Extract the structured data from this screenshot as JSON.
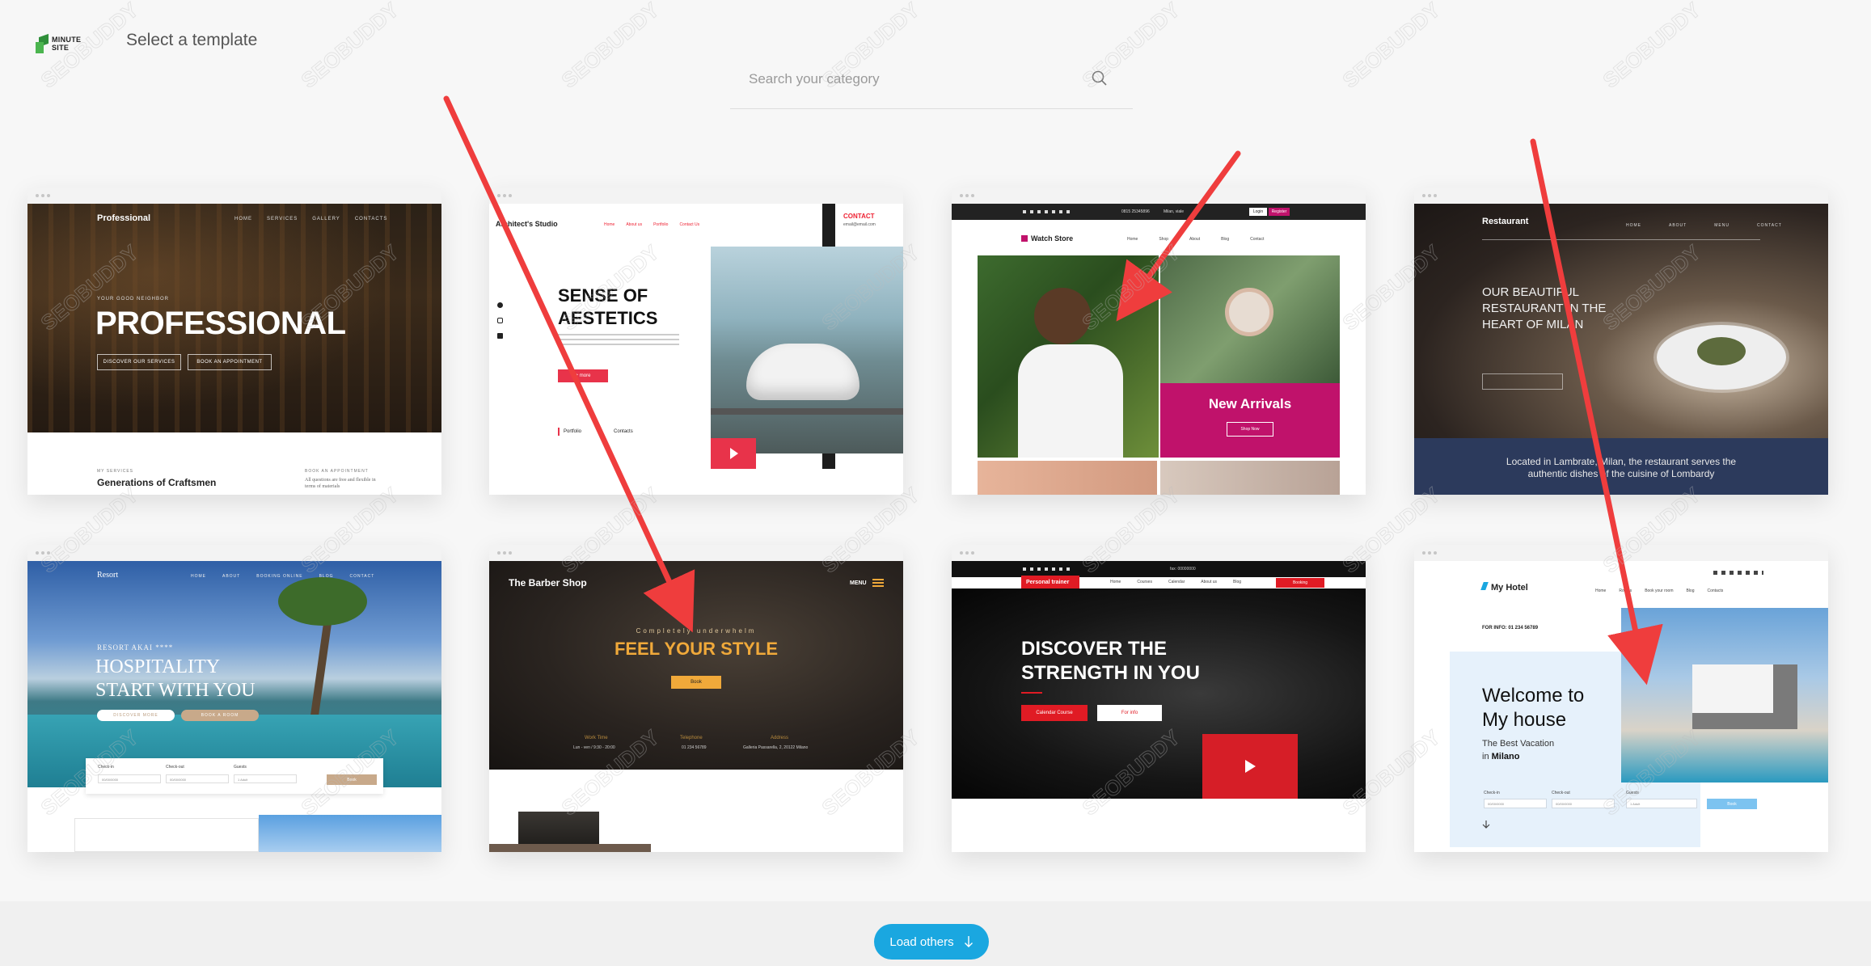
{
  "header": {
    "logo_line1": "MINUTE",
    "logo_line2": "SITE",
    "title": "Select a template",
    "search_placeholder": "Search your category",
    "search_icon": "search-icon"
  },
  "templates": [
    {
      "name": "Professional",
      "nav": [
        "HOME",
        "SERVICES",
        "GALLERY",
        "CONTACTS"
      ],
      "kicker": "YOUR GOOD NEIGHBOR",
      "headline": "PROFESSIONAL",
      "buttons": [
        "DISCOVER OUR SERVICES",
        "BOOK AN APPOINTMENT"
      ],
      "section_kicker": "MY SERVICES",
      "section_title": "Generations of Craftsmen",
      "aside_kicker": "BOOK AN APPOINTMENT",
      "aside_text": "All questions are free and flexible in terms of materials"
    },
    {
      "name": "Architect's Studio",
      "nav": [
        "Home",
        "About us",
        "Portfolio",
        "Contact Us"
      ],
      "contact_label": "CONTACT",
      "contact_email": "email@email.com",
      "headline_line1": "SENSE OF",
      "headline_line2": "AESTETICS",
      "button": "+ more",
      "footer_links": [
        "Portfolio",
        "Contacts"
      ],
      "social_icons": [
        "facebook-icon",
        "instagram-icon",
        "linkedin-icon"
      ]
    },
    {
      "name": "Watch Store",
      "topbar_phone": "0815 25345896",
      "topbar_city": "Milan, viale",
      "login": "Login",
      "register": "Register",
      "nav": [
        "Home",
        "Shop",
        "About",
        "Blog",
        "Contact"
      ],
      "promo_title": "New Arrivals",
      "promo_button": "Shop Now"
    },
    {
      "name": "Restaurant",
      "nav": [
        "HOME",
        "ABOUT",
        "MENU",
        "CONTACT"
      ],
      "headline_line1": "OUR BEAUTIFUL",
      "headline_line2": "RESTAURANT IN THE",
      "headline_line3": "HEART OF MILAN",
      "footer_line1": "Located in Lambrate, Milan, the restaurant serves the",
      "footer_line2": "authentic dishes of the cuisine of Lombardy"
    },
    {
      "name": "Resort",
      "nav": [
        "HOME",
        "ABOUT",
        "BOOKING ONLINE",
        "BLOG",
        "CONTACT"
      ],
      "kicker": "RESORT AKAI ****",
      "headline_line1": "HOSPITALITY",
      "headline_line2": "START WITH YOU",
      "buttons": [
        "DISCOVER MORE",
        "BOOK A ROOM"
      ],
      "booking_labels": [
        "Check-in",
        "Check-out",
        "Guests"
      ],
      "booking_values": [
        "00/00/0000",
        "00/00/0000",
        "1 Adult"
      ],
      "booking_button": "Book"
    },
    {
      "name": "The Barber Shop",
      "menu": "MENU",
      "kicker": "Completely underwhelm",
      "headline": "FEEL YOUR STYLE",
      "button": "Book",
      "info_labels": [
        "Work Time",
        "Telephone",
        "Address"
      ],
      "info_values": [
        "Lun - ven / 9:30 - 20:00",
        "01 234 56789",
        "Galleria Passarella, 2, 20122 Milano"
      ]
    },
    {
      "name": "Personal trainer",
      "topbar_text": "fax: 00000000",
      "nav": [
        "Home",
        "Courses",
        "Calendar",
        "About us",
        "Blog"
      ],
      "nav_cta": "Booking",
      "headline_line1": "DISCOVER THE",
      "headline_line2": "STRENGTH IN YOU",
      "buttons": [
        "Calendar Course",
        "For info"
      ]
    },
    {
      "name": "My Hotel",
      "nav": [
        "Home",
        "Rooms",
        "Book your room",
        "Blog",
        "Contacts"
      ],
      "info": "FOR INFO: 01 234 56789",
      "headline_line1": "Welcome to",
      "headline_line2": "My house",
      "sub_line1": "The Best Vacation",
      "sub_line2": "in",
      "sub_city": "Milano",
      "booking_labels": [
        "Check-in",
        "Check-out",
        "Guests"
      ],
      "booking_values": [
        "00/00/0000",
        "00/00/0000",
        "1 Adult"
      ],
      "booking_button": "Book"
    }
  ],
  "load_more": {
    "label": "Load others",
    "icon": "arrow-down-icon"
  },
  "watermark": "SEOBUDDY",
  "colors": {
    "accent": "#1aa7e0",
    "arrow": "#ef3d3d",
    "watch_magenta": "#c0126b",
    "trainer_red": "#e01b24",
    "barber_gold": "#f0a93a",
    "restaurant_navy": "#2c3a5c",
    "hotel_blue": "#e6f1fb"
  }
}
